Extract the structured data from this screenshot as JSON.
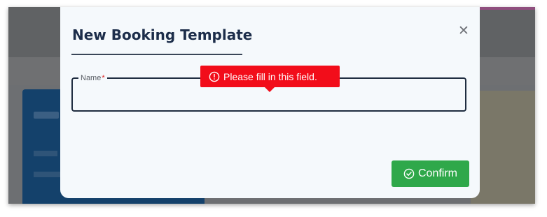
{
  "modal": {
    "title": "New Booking Template",
    "close_icon": "close-icon",
    "field": {
      "label": "Name",
      "required_marker": "*",
      "value": ""
    },
    "validation": {
      "message": "Please fill in this field.",
      "icon": "exclamation-circle-icon"
    },
    "confirm": {
      "label": "Confirm",
      "icon": "check-circle-icon"
    }
  },
  "colors": {
    "title": "#1c2d4a",
    "error": "#f20d1a",
    "confirm": "#2fa84a",
    "modal_bg": "#f5f9fc"
  }
}
